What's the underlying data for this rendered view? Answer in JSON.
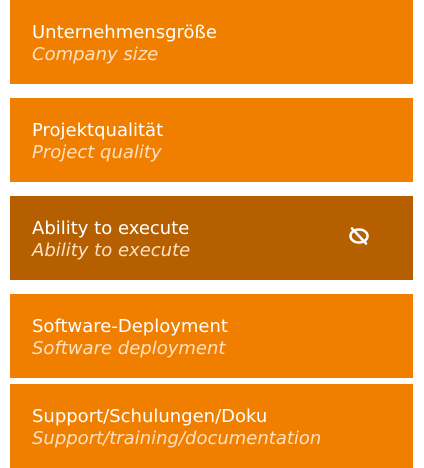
{
  "items": [
    {
      "label": "Unternehmensgröße",
      "sublabel": "Company size",
      "active": false
    },
    {
      "label": "Projektqualität",
      "sublabel": "Project quality",
      "active": false
    },
    {
      "label": "Ability to execute",
      "sublabel": "Ability to execute",
      "active": true,
      "icon": "eye-slash-icon"
    },
    {
      "label": "Software-Deployment",
      "sublabel": "Software deployment",
      "active": false
    },
    {
      "label": "Support/Schulungen/Doku",
      "sublabel": "Support/training/documentation",
      "active": false
    }
  ],
  "colors": {
    "card": "#f07f00",
    "card_active": "#b55f00",
    "text": "#ffffff",
    "subtext": "#ffe0bf"
  }
}
